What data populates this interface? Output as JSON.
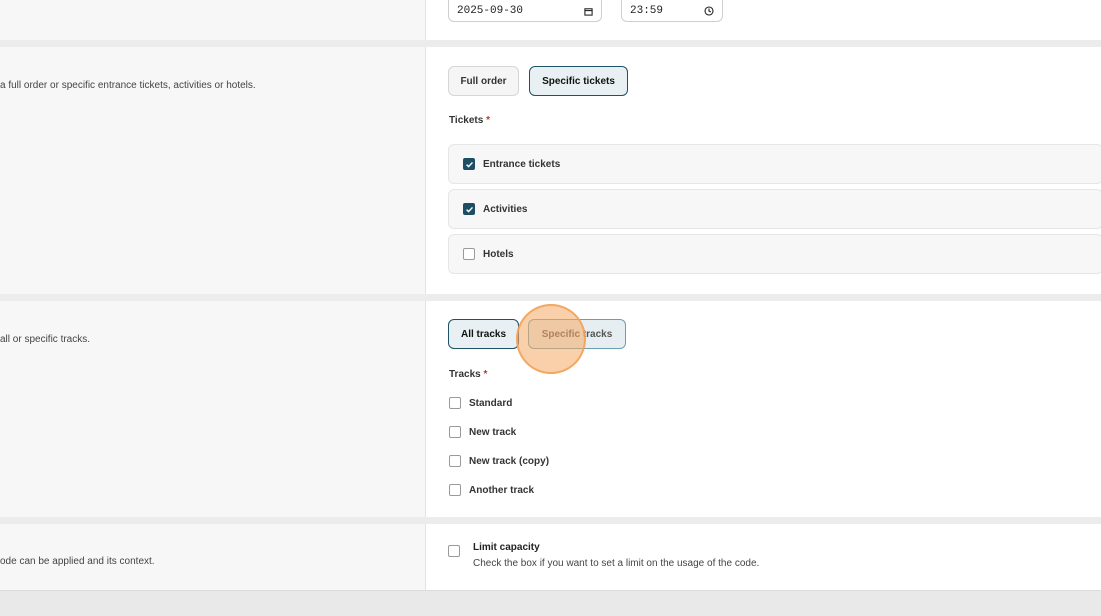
{
  "date_section": {
    "date_value": "2025-09-30",
    "time_value": "23:59"
  },
  "tickets_section": {
    "description": "a full order or specific entrance tickets, activities or hotels.",
    "scope_options": [
      {
        "label": "Full order",
        "active": false
      },
      {
        "label": "Specific tickets",
        "active": true
      }
    ],
    "tickets_label": "Tickets",
    "required_mark": "*",
    "tickets": [
      {
        "label": "Entrance tickets",
        "checked": true
      },
      {
        "label": "Activities",
        "checked": true
      },
      {
        "label": "Hotels",
        "checked": false
      }
    ]
  },
  "tracks_section": {
    "description": "all or specific tracks.",
    "scope_options": [
      {
        "label": "All tracks",
        "active": true
      },
      {
        "label": "Specific tracks",
        "active": false
      }
    ],
    "tracks_label": "Tracks",
    "required_mark": "*",
    "tracks": [
      {
        "label": "Standard",
        "checked": false
      },
      {
        "label": "New track",
        "checked": false
      },
      {
        "label": "New track (copy)",
        "checked": false
      },
      {
        "label": "Another track",
        "checked": false
      }
    ]
  },
  "capacity_section": {
    "description": "ode can be applied and its context.",
    "limit_label": "Limit capacity",
    "limit_help": "Check the box if you want to set a limit on the usage of the code.",
    "limit_checked": false
  },
  "colors": {
    "accent": "#1d4e63",
    "cursor_highlight": "#f6aa64"
  }
}
